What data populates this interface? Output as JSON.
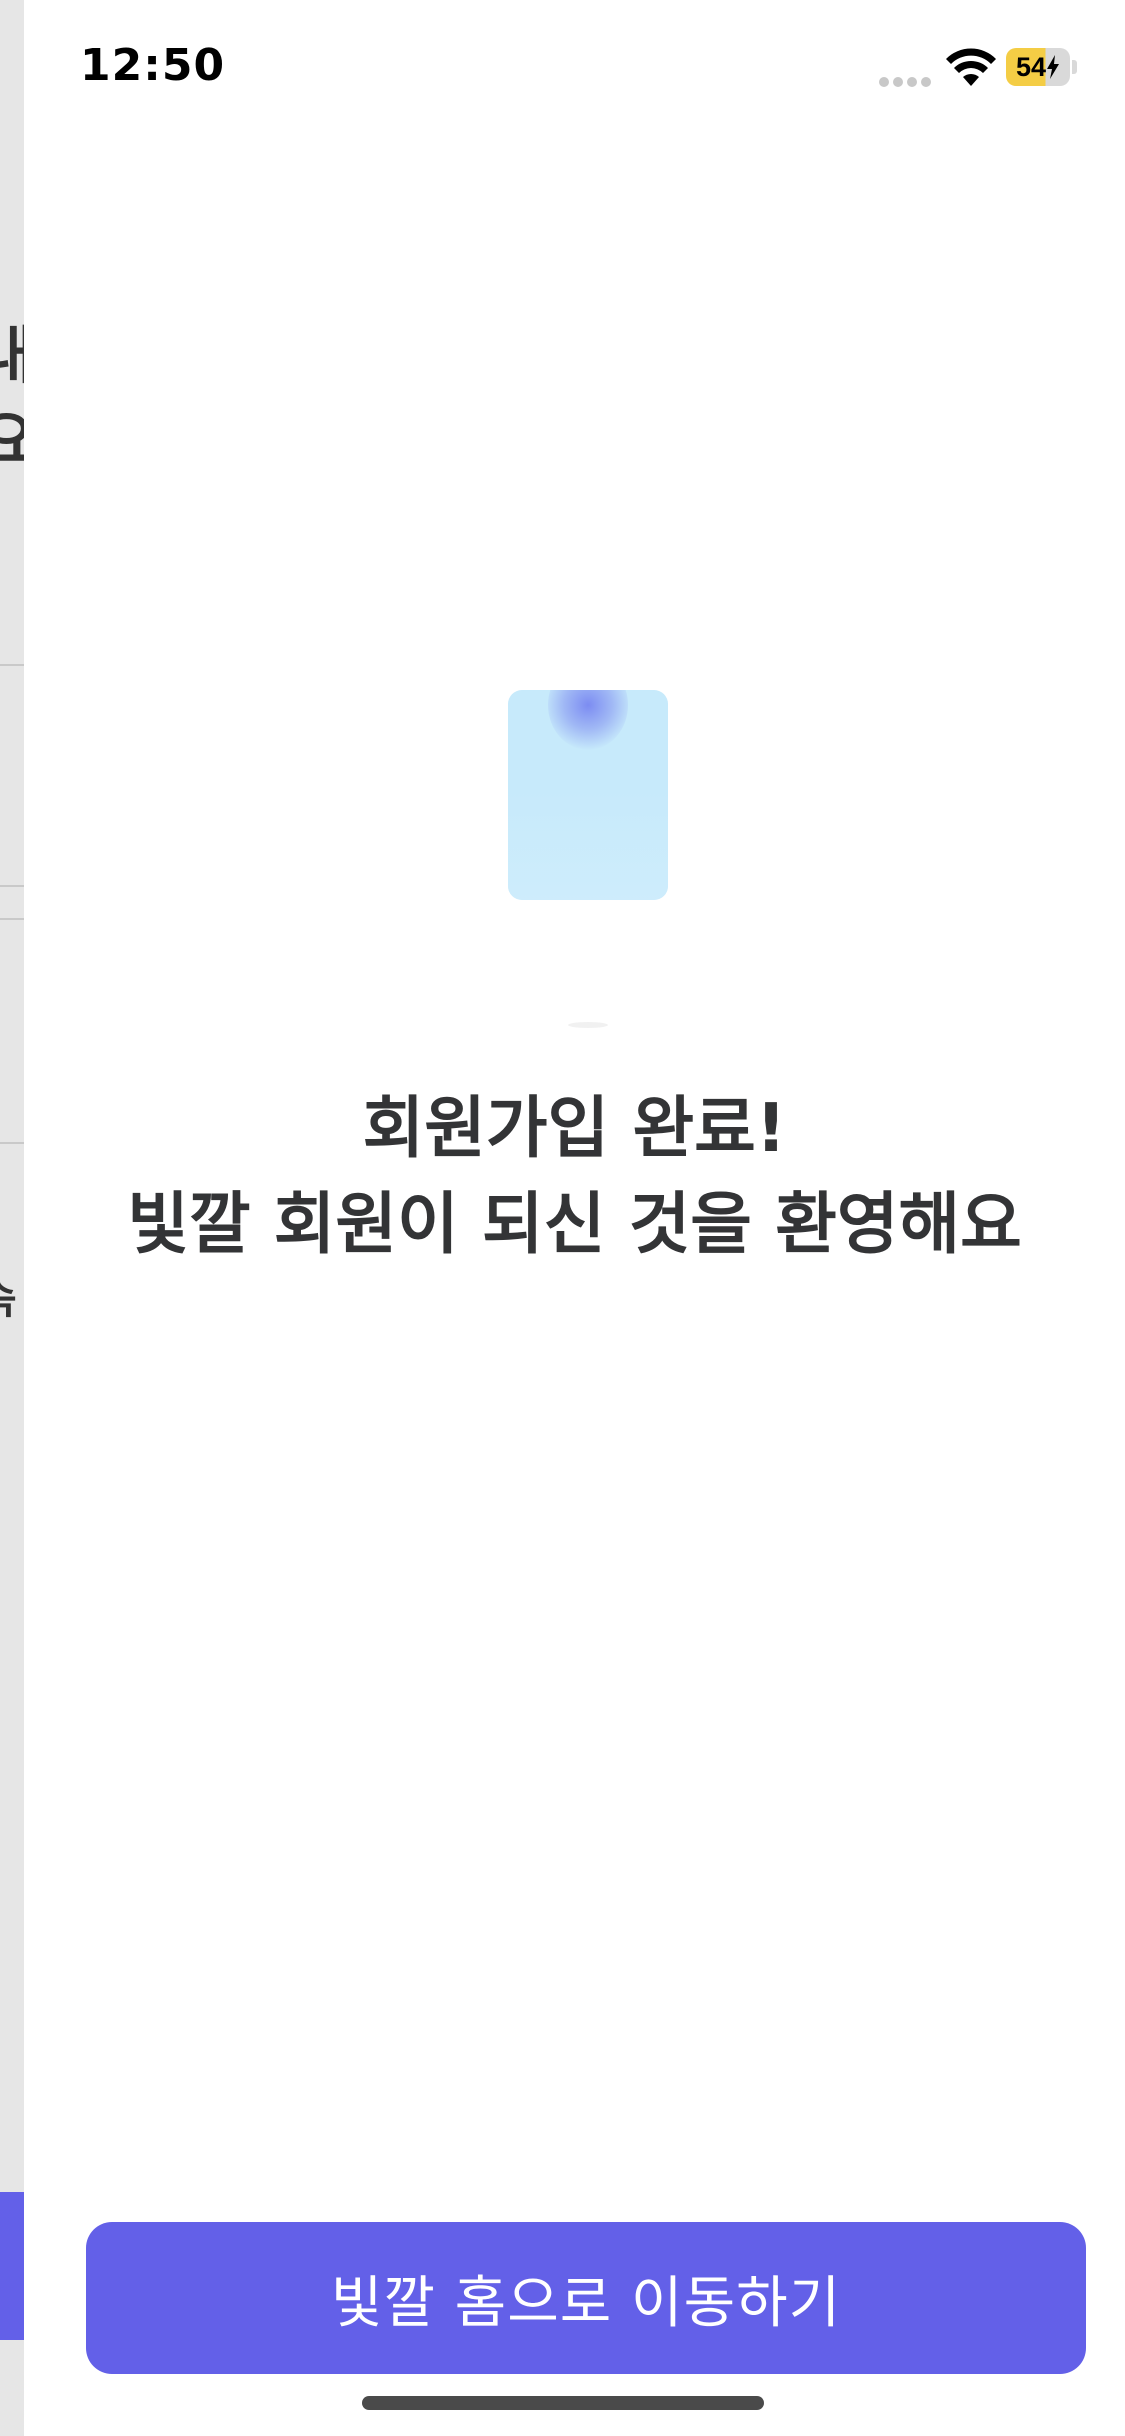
{
  "status_bar": {
    "time": "12:50",
    "battery_level": "54",
    "battery_charging": true,
    "signal_icon": "cellular-signal-icon",
    "wifi_icon": "wifi-icon",
    "battery_color": "#f4cd45"
  },
  "underlying_page": {
    "line1": "내",
    "line2": "요",
    "line3": ")",
    "line4": "속",
    "accent_color": "#6360e8"
  },
  "main": {
    "illustration_icon": "welcome-card-illustration",
    "welcome_title": "회원가입 완료!",
    "welcome_subtitle": "빛깔 회원이 되신 것을 환영해요"
  },
  "footer": {
    "home_button_label": "빛깔 홈으로 이동하기",
    "button_color": "#6360e8"
  }
}
